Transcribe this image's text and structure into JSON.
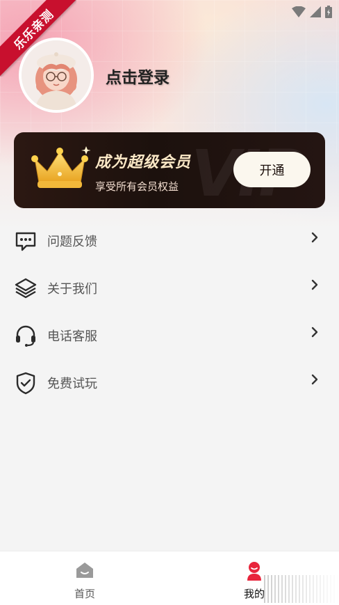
{
  "watermark": {
    "text": "乐乐亲测"
  },
  "profile": {
    "login_text": "点击登录",
    "avatar_icon": "avatar-girl-glasses"
  },
  "vip": {
    "title": "成为超级会员",
    "subtitle": "享受所有会员权益",
    "button_label": "开通",
    "watermark": "VIP",
    "icon": "crown-icon",
    "accent": "#fbe8c6"
  },
  "menu": {
    "items": [
      {
        "label": "问题反馈",
        "icon": "chat-bubble-icon"
      },
      {
        "label": "关于我们",
        "icon": "layers-icon"
      },
      {
        "label": "电话客服",
        "icon": "headset-icon"
      },
      {
        "label": "免费试玩",
        "icon": "shield-check-icon"
      }
    ]
  },
  "bottom_nav": {
    "items": [
      {
        "label": "首页",
        "icon": "home-icon",
        "active": false
      },
      {
        "label": "我的",
        "icon": "user-icon",
        "active": true
      }
    ],
    "active_color": "#e8253c",
    "inactive_color": "#999999"
  }
}
